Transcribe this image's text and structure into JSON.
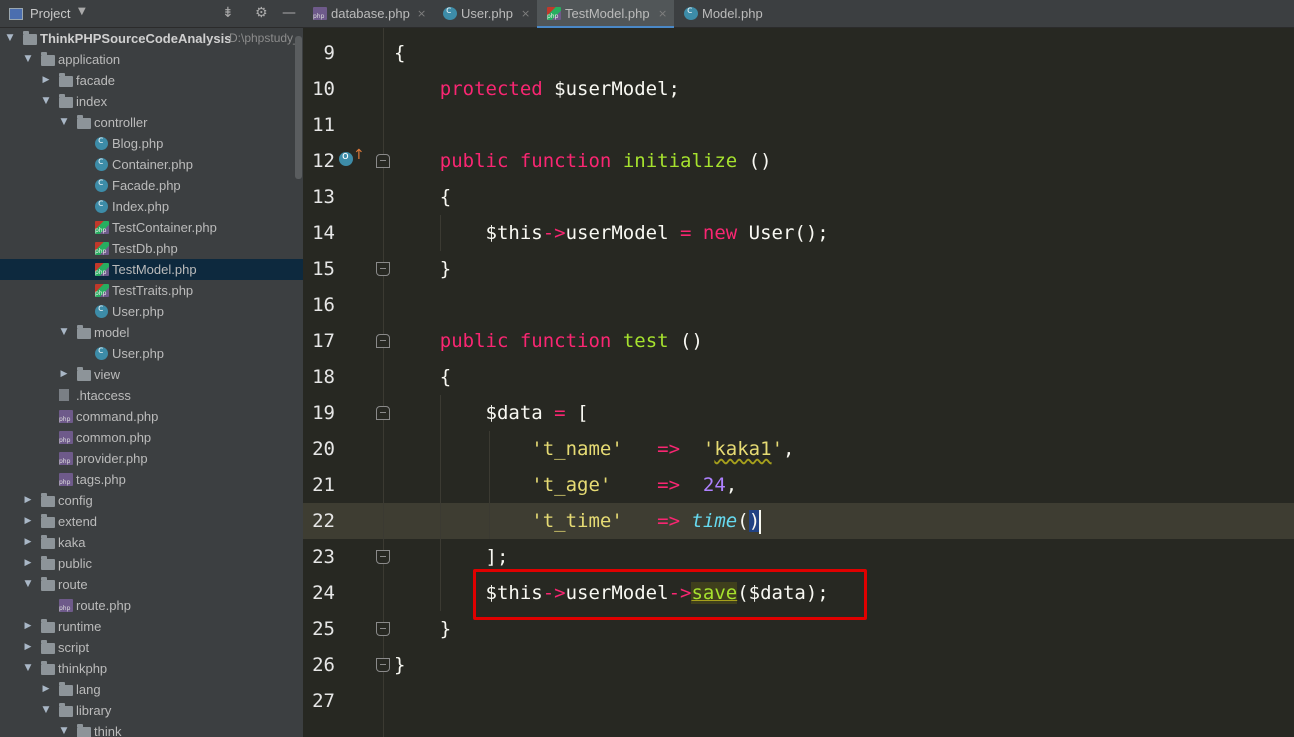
{
  "project_panel": {
    "title": "Project",
    "root_path": "D:\\phpstudy_",
    "tree": [
      {
        "label": "ThinkPHPSourceCodeAnalysis",
        "type": "root-folder",
        "depth": 0,
        "expanded": true
      },
      {
        "label": "application",
        "type": "folder",
        "depth": 1,
        "expanded": true
      },
      {
        "label": "facade",
        "type": "folder",
        "depth": 2,
        "expanded": false
      },
      {
        "label": "index",
        "type": "folder",
        "depth": 2,
        "expanded": true
      },
      {
        "label": "controller",
        "type": "folder",
        "depth": 3,
        "expanded": true
      },
      {
        "label": "Blog.php",
        "type": "class",
        "depth": 4
      },
      {
        "label": "Container.php",
        "type": "class",
        "depth": 4
      },
      {
        "label": "Facade.php",
        "type": "class",
        "depth": 4
      },
      {
        "label": "Index.php",
        "type": "class",
        "depth": 4
      },
      {
        "label": "TestContainer.php",
        "type": "php-class",
        "depth": 4
      },
      {
        "label": "TestDb.php",
        "type": "php-class",
        "depth": 4
      },
      {
        "label": "TestModel.php",
        "type": "php-class",
        "depth": 4,
        "selected": true
      },
      {
        "label": "TestTraits.php",
        "type": "php-class",
        "depth": 4
      },
      {
        "label": "User.php",
        "type": "class",
        "depth": 4
      },
      {
        "label": "model",
        "type": "folder",
        "depth": 3,
        "expanded": true
      },
      {
        "label": "User.php",
        "type": "class",
        "depth": 4
      },
      {
        "label": "view",
        "type": "folder",
        "depth": 3,
        "expanded": false
      },
      {
        "label": ".htaccess",
        "type": "file",
        "depth": 2
      },
      {
        "label": "command.php",
        "type": "php",
        "depth": 2
      },
      {
        "label": "common.php",
        "type": "php",
        "depth": 2
      },
      {
        "label": "provider.php",
        "type": "php",
        "depth": 2
      },
      {
        "label": "tags.php",
        "type": "php",
        "depth": 2
      },
      {
        "label": "config",
        "type": "folder",
        "depth": 1,
        "expanded": false
      },
      {
        "label": "extend",
        "type": "folder",
        "depth": 1,
        "expanded": false
      },
      {
        "label": "kaka",
        "type": "folder",
        "depth": 1,
        "expanded": false
      },
      {
        "label": "public",
        "type": "folder",
        "depth": 1,
        "expanded": false
      },
      {
        "label": "route",
        "type": "folder",
        "depth": 1,
        "expanded": true
      },
      {
        "label": "route.php",
        "type": "php",
        "depth": 2
      },
      {
        "label": "runtime",
        "type": "folder",
        "depth": 1,
        "expanded": false
      },
      {
        "label": "script",
        "type": "folder",
        "depth": 1,
        "expanded": false
      },
      {
        "label": "thinkphp",
        "type": "folder",
        "depth": 1,
        "expanded": true
      },
      {
        "label": "lang",
        "type": "folder",
        "depth": 2,
        "expanded": false
      },
      {
        "label": "library",
        "type": "folder",
        "depth": 2,
        "expanded": true
      },
      {
        "label": "think",
        "type": "folder",
        "depth": 3,
        "expanded": true
      }
    ]
  },
  "tabs": [
    {
      "label": "database.php",
      "icon": "php-file-icon",
      "active": false
    },
    {
      "label": "User.php",
      "icon": "class-icon",
      "active": false
    },
    {
      "label": "TestModel.php",
      "icon": "php-class-icon",
      "active": true
    },
    {
      "label": "Model.php",
      "icon": "class-icon",
      "active": false
    }
  ],
  "editor": {
    "current_line": 22,
    "highlighted_lines": [
      24
    ],
    "lines": [
      {
        "n": "9",
        "tokens": [
          [
            "{",
            "p"
          ]
        ]
      },
      {
        "n": "10",
        "tokens": [
          [
            "    ",
            "p"
          ],
          [
            "protected",
            "kw"
          ],
          [
            " $userModel;",
            "p"
          ]
        ]
      },
      {
        "n": "11",
        "tokens": []
      },
      {
        "n": "12",
        "tokens": [
          [
            "    ",
            "p"
          ],
          [
            "public",
            "kw"
          ],
          [
            " ",
            "p"
          ],
          [
            "function",
            "kw"
          ],
          [
            " ",
            "p"
          ],
          [
            "initialize",
            "fn"
          ],
          [
            " ()",
            "p"
          ]
        ]
      },
      {
        "n": "13",
        "tokens": [
          [
            "    {",
            "p"
          ]
        ]
      },
      {
        "n": "14",
        "tokens": [
          [
            "        $this",
            "p"
          ],
          [
            "->",
            "kw"
          ],
          [
            "userModel ",
            "p"
          ],
          [
            "=",
            "kw"
          ],
          [
            " ",
            "p"
          ],
          [
            "new",
            "kw"
          ],
          [
            " User();",
            "p"
          ]
        ]
      },
      {
        "n": "15",
        "tokens": [
          [
            "    }",
            "p"
          ]
        ]
      },
      {
        "n": "16",
        "tokens": []
      },
      {
        "n": "17",
        "tokens": [
          [
            "    ",
            "p"
          ],
          [
            "public",
            "kw"
          ],
          [
            " ",
            "p"
          ],
          [
            "function",
            "kw"
          ],
          [
            " ",
            "p"
          ],
          [
            "test",
            "fn"
          ],
          [
            " ()",
            "p"
          ]
        ]
      },
      {
        "n": "18",
        "tokens": [
          [
            "    {",
            "p"
          ]
        ]
      },
      {
        "n": "19",
        "tokens": [
          [
            "        $data ",
            "p"
          ],
          [
            "=",
            "kw"
          ],
          [
            " [",
            "p"
          ]
        ]
      },
      {
        "n": "20",
        "tokens": [
          [
            "            ",
            "p"
          ],
          [
            "'t_name'",
            "str"
          ],
          [
            "   ",
            "p"
          ],
          [
            "=>",
            "kw"
          ],
          [
            "  ",
            "p"
          ],
          [
            "'",
            "str"
          ],
          [
            "kaka1",
            "strw"
          ],
          [
            "'",
            "str"
          ],
          [
            ",",
            "p"
          ]
        ]
      },
      {
        "n": "21",
        "tokens": [
          [
            "            ",
            "p"
          ],
          [
            "'t_age'",
            "str"
          ],
          [
            "    ",
            "p"
          ],
          [
            "=>",
            "kw"
          ],
          [
            "  ",
            "p"
          ],
          [
            "24",
            "num"
          ],
          [
            ",",
            "p"
          ]
        ]
      },
      {
        "n": "22",
        "tokens": [
          [
            "            ",
            "p"
          ],
          [
            "'t_time'",
            "str"
          ],
          [
            "   ",
            "p"
          ],
          [
            "=>",
            "kw"
          ],
          [
            " ",
            "p"
          ],
          [
            "time",
            "itl"
          ],
          [
            "(",
            "p"
          ],
          [
            ")",
            "brk"
          ]
        ]
      },
      {
        "n": "23",
        "tokens": [
          [
            "        ];",
            "p"
          ]
        ]
      },
      {
        "n": "24",
        "tokens": [
          [
            "        $this",
            "p"
          ],
          [
            "->",
            "kw"
          ],
          [
            "userModel",
            "p"
          ],
          [
            "->",
            "kw"
          ],
          [
            "save",
            "hl"
          ],
          [
            "($data);",
            "p"
          ]
        ]
      },
      {
        "n": "25",
        "tokens": [
          [
            "    }",
            "p"
          ]
        ]
      },
      {
        "n": "26",
        "tokens": [
          [
            "}",
            "p"
          ]
        ]
      },
      {
        "n": "27",
        "tokens": []
      }
    ]
  }
}
